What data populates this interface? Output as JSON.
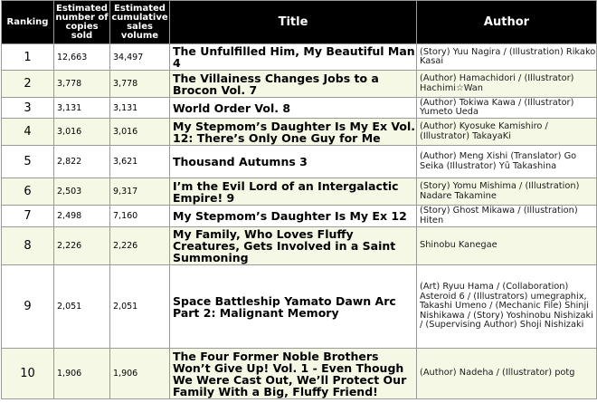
{
  "headers": {
    "ranking": "Ranking",
    "copies_sold": "Estimated number of copies sold",
    "cumulative": "Estimated cumulative sales volume",
    "title": "Title",
    "author": "Author"
  },
  "rows": [
    {
      "rank": "1",
      "copies": "12,663",
      "cumulative": "34,497",
      "title": "The Unfulfilled Him, My Beautiful Man 4",
      "author": "(Story) Yuu Nagira / (Illustration) Rikako Kasai"
    },
    {
      "rank": "2",
      "copies": "3,778",
      "cumulative": "3,778",
      "title": "The Villainess Changes Jobs to a Brocon Vol. 7",
      "author": "(Author) Hamachidori / (Illustrator) Hachimi☆Wan"
    },
    {
      "rank": "3",
      "copies": "3,131",
      "cumulative": "3,131",
      "title": "World Order Vol. 8",
      "author": "(Author) Tokiwa Kawa / (Illustrator) Yumeto Ueda"
    },
    {
      "rank": "4",
      "copies": "3,016",
      "cumulative": "3,016",
      "title": "My Stepmom’s Daughter Is My Ex Vol. 12: There’s Only One Guy for Me",
      "author": "(Author) Kyosuke Kamishiro / (Illustrator) TakayaKi"
    },
    {
      "rank": "5",
      "copies": "2,822",
      "cumulative": "3,621",
      "title": "Thousand Autumns 3",
      "author": "(Author) Meng Xishi (Translator) Go Seika (Illustrator) Yū Takashina"
    },
    {
      "rank": "6",
      "copies": "2,503",
      "cumulative": "9,317",
      "title": "I’m the Evil Lord of an Intergalactic Empire! 9",
      "author": "(Story) Yomu Mishima / (Illustration) Nadare Takamine"
    },
    {
      "rank": "7",
      "copies": "2,498",
      "cumulative": "7,160",
      "title": "My Stepmom’s Daughter Is My Ex 12",
      "author": "(Story) Ghost Mikawa / (Illustration) Hiten"
    },
    {
      "rank": "8",
      "copies": "2,226",
      "cumulative": "2,226",
      "title": "My Family, Who Loves Fluffy Creatures, Gets Involved in a Saint Summoning",
      "author": "Shinobu Kanegae"
    },
    {
      "rank": "9",
      "copies": "2,051",
      "cumulative": "2,051",
      "title": "Space Battleship Yamato Dawn Arc Part 2: Malignant Memory",
      "author": "(Art) Ryuu Hama / (Collaboration) Asteroid 6 / (Illustrators) umegraphix, Takashi Umeno / (Mechanic File) Shinji Nishikawa / (Story) Yoshinobu Nishizaki / (Supervising Author) Shoji Nishizaki"
    },
    {
      "rank": "10",
      "copies": "1,906",
      "cumulative": "1,906",
      "title": "The Four Former Noble Brothers Won’t Give Up! Vol. 1 - Even Though We Were Cast Out, We’ll Protect Our Family With a Big, Fluffy Friend!",
      "author": "(Author) Nadeha / (Illustrator) potg"
    }
  ]
}
